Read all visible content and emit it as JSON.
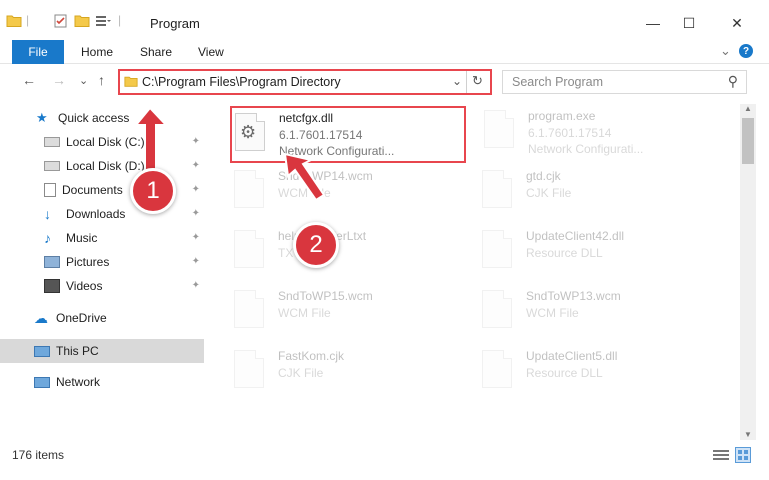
{
  "window": {
    "title": "Program",
    "minimize_glyph": "—",
    "maximize_glyph": "☐",
    "close_glyph": "✕"
  },
  "ribbon": {
    "file": "File",
    "tabs": [
      "Home",
      "Share",
      "View"
    ],
    "expand_glyph": "⌄",
    "help_glyph": "?"
  },
  "address": {
    "path": "C:\\Program Files\\Program Directory",
    "dropdown_glyph": "⌄",
    "refresh_glyph": "↻"
  },
  "search": {
    "placeholder": "Search Program",
    "icon_glyph": "⚲"
  },
  "nav": {
    "back": "←",
    "forward": "→",
    "recent": "⌄",
    "up": "↑"
  },
  "sidebar": {
    "quick_access": "Quick access",
    "items": [
      "Local Disk (C:)",
      "Local Disk (D:)",
      "Documents",
      "Downloads",
      "Music",
      "Pictures",
      "Videos"
    ],
    "pin_glyph": "📌",
    "onedrive": "OneDrive",
    "this_pc": "This PC",
    "network": "Network"
  },
  "files": {
    "highlighted": {
      "name": "netcfgx.dll",
      "version": "6.1.7601.17514",
      "desc": "Network Configurati..."
    },
    "program_exe": {
      "name": "program.exe",
      "version": "6.1.7601.17514",
      "desc": "Network Configurati..."
    },
    "left": [
      {
        "name": "SndToWP14.wcm",
        "type": "WCM File"
      },
      {
        "name": "help_ReaderLtxt",
        "type": "TXT File"
      },
      {
        "name": "SndToWP15.wcm",
        "type": "WCM File"
      },
      {
        "name": "FastKom.cjk",
        "type": "CJK File"
      }
    ],
    "right": [
      {
        "name": "gtd.cjk",
        "type": "CJK File"
      },
      {
        "name": "UpdateClient42.dll",
        "type": "Resource DLL"
      },
      {
        "name": "SndToWP13.wcm",
        "type": "WCM File"
      },
      {
        "name": "UpdateClient5.dll",
        "type": "Resource DLL"
      }
    ]
  },
  "status": {
    "count": "176 items"
  },
  "callouts": {
    "one": "1",
    "two": "2"
  },
  "colors": {
    "accent": "#1979ca",
    "highlight": "#e8464e",
    "callout": "#d9363e"
  }
}
